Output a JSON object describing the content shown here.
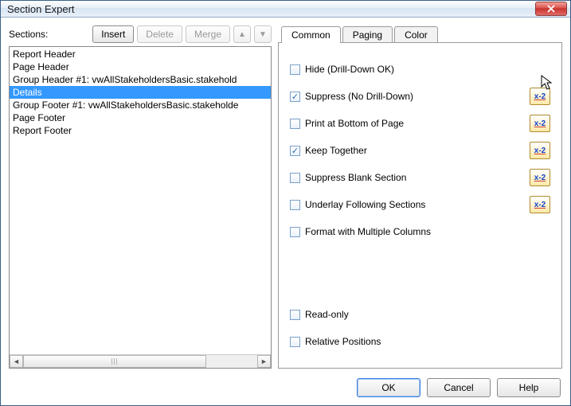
{
  "window": {
    "title": "Section Expert"
  },
  "left": {
    "label": "Sections:",
    "buttons": {
      "insert": "Insert",
      "delete": "Delete",
      "merge": "Merge"
    },
    "items": [
      {
        "label": "Report Header",
        "selected": false
      },
      {
        "label": "Page Header",
        "selected": false
      },
      {
        "label": "Group Header #1: vwAllStakeholdersBasic.stakehold",
        "selected": false
      },
      {
        "label": "Details",
        "selected": true
      },
      {
        "label": "Group Footer #1: vwAllStakeholdersBasic.stakeholde",
        "selected": false
      },
      {
        "label": "Page Footer",
        "selected": false
      },
      {
        "label": "Report Footer",
        "selected": false
      }
    ]
  },
  "tabs": [
    {
      "label": "Common",
      "active": true
    },
    {
      "label": "Paging",
      "active": false
    },
    {
      "label": "Color",
      "active": false
    }
  ],
  "options_top": [
    {
      "key": "hide",
      "label": "Hide (Drill-Down OK)",
      "checked": false,
      "formula": false
    },
    {
      "key": "suppress",
      "label": "Suppress (No Drill-Down)",
      "checked": true,
      "formula": true
    },
    {
      "key": "bottom",
      "label": "Print at Bottom of Page",
      "checked": false,
      "formula": true
    },
    {
      "key": "keep",
      "label": "Keep Together",
      "checked": true,
      "formula": true
    },
    {
      "key": "blank",
      "label": "Suppress Blank Section",
      "checked": false,
      "formula": true
    },
    {
      "key": "underlay",
      "label": "Underlay Following Sections",
      "checked": false,
      "formula": true
    },
    {
      "key": "multicol",
      "label": "Format with Multiple Columns",
      "checked": false,
      "formula": false
    }
  ],
  "options_bottom": [
    {
      "key": "readonly",
      "label": "Read-only",
      "checked": false
    },
    {
      "key": "relpos",
      "label": "Relative Positions",
      "checked": false
    }
  ],
  "footer": {
    "ok": "OK",
    "cancel": "Cancel",
    "help": "Help"
  },
  "formula_glyph": "x-2"
}
